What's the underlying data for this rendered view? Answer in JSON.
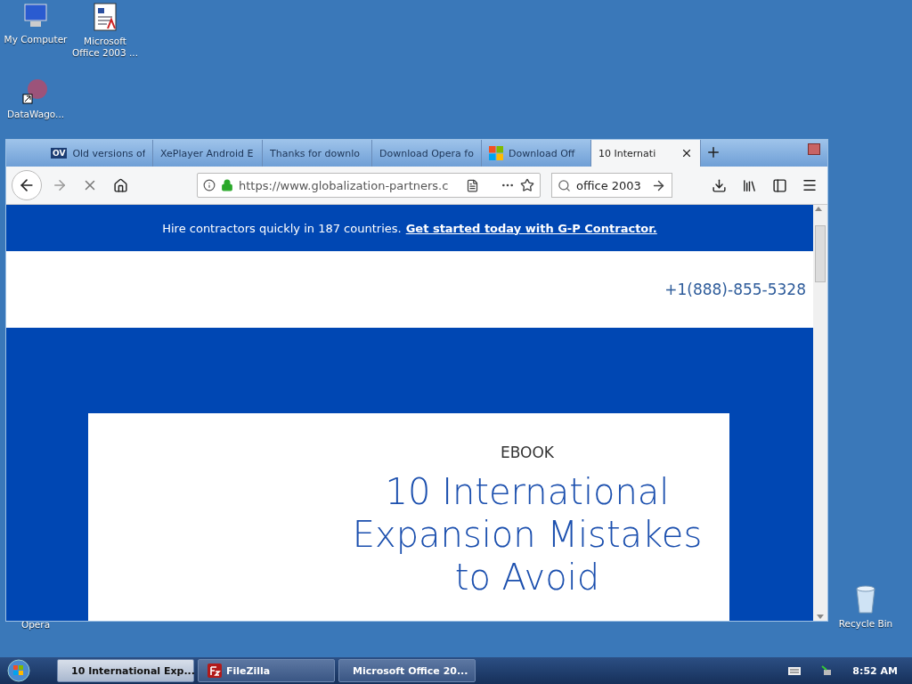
{
  "desktop": {
    "icons": [
      {
        "label": "My Computer",
        "kind": "computer"
      },
      {
        "label": "Microsoft Office 2003 ...",
        "kind": "document"
      },
      {
        "label": "DataWago...",
        "kind": "shortcut"
      },
      {
        "label": "Opera",
        "kind": "hidden"
      },
      {
        "label": "Recycle Bin",
        "kind": "recycle"
      }
    ]
  },
  "browser": {
    "tabs": [
      {
        "label": "Old versions of",
        "selected": false,
        "kind": "ov",
        "badge": "OV"
      },
      {
        "label": "XePlayer Android E",
        "selected": false,
        "kind": "plain"
      },
      {
        "label": "Thanks for downlo",
        "selected": false,
        "kind": "plain"
      },
      {
        "label": "Download Opera fo",
        "selected": false,
        "kind": "plain"
      },
      {
        "label": "Download Off",
        "selected": false,
        "kind": "windows"
      },
      {
        "label": "10 Internati",
        "selected": true,
        "kind": "plain"
      }
    ],
    "url": "https://www.globalization-partners.c",
    "search": "office 2003"
  },
  "page": {
    "banner": "Hire contractors quickly in 187 countries.",
    "banner_link": "Get started today with G-P Contractor.",
    "phone": "+1(888)-855-5328",
    "ebook": "EBOOK",
    "title": "10 International Expansion Mistakes to Avoid"
  },
  "taskbar": {
    "buttons": [
      {
        "label": "10 International Exp...",
        "selected": true,
        "kind": "browser"
      },
      {
        "label": "FileZilla",
        "selected": false,
        "kind": "filezilla"
      },
      {
        "label": "Microsoft Office 20...",
        "selected": false,
        "kind": "document"
      }
    ],
    "clock": "8:52 AM"
  }
}
